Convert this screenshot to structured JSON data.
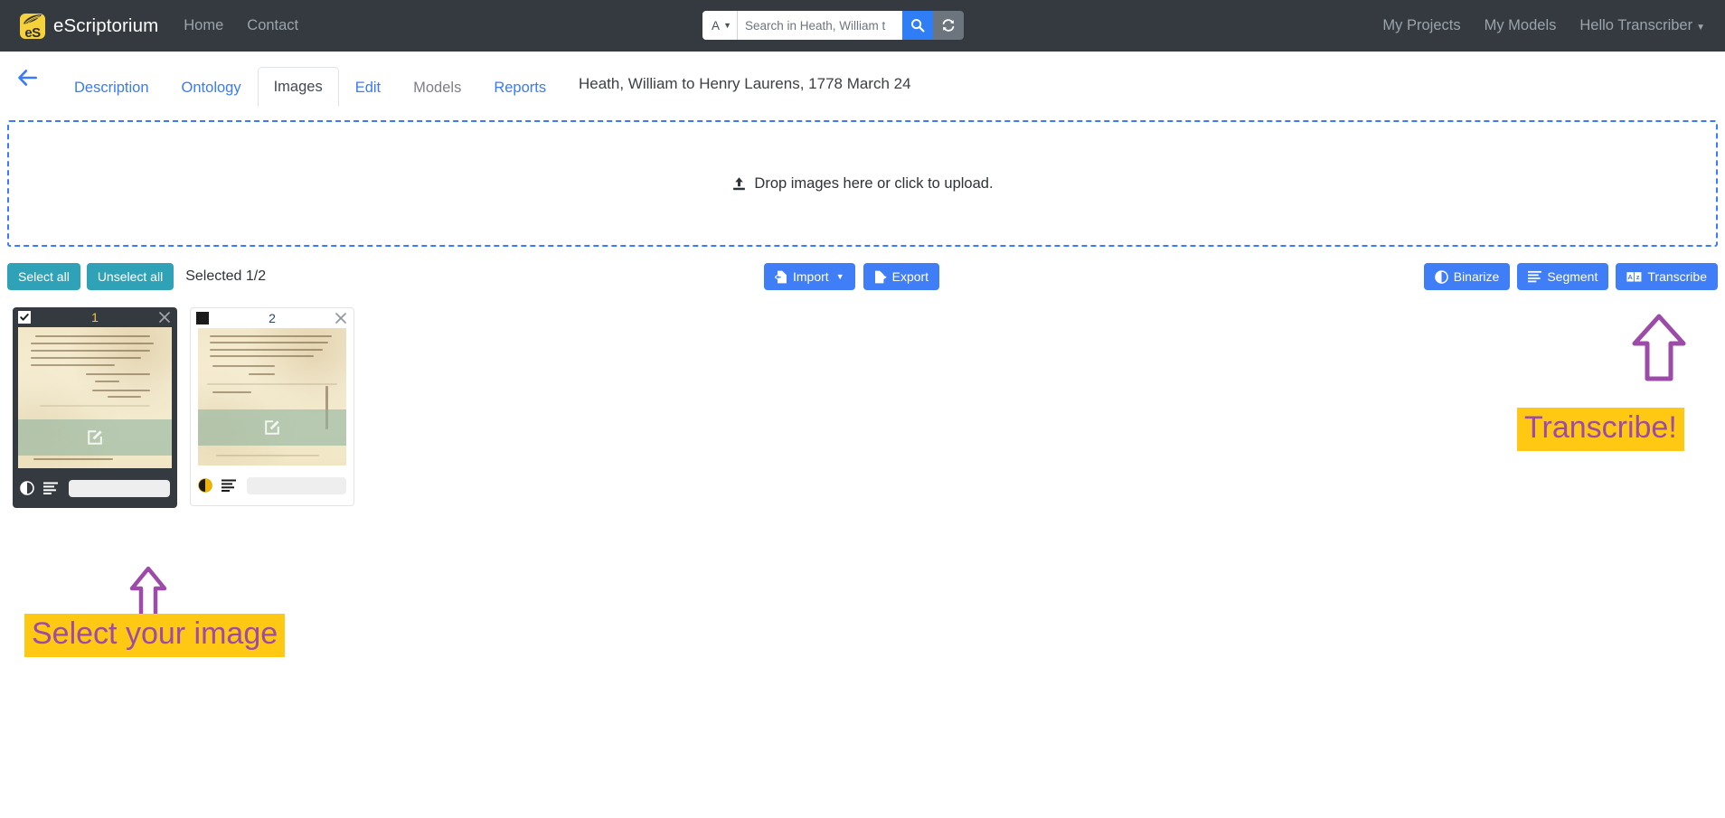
{
  "navbar": {
    "brand": "eScriptorium",
    "brand_logo_letters": "eS",
    "links": [
      {
        "label": "Home",
        "name": "nav-link-home"
      },
      {
        "label": "Contact",
        "name": "nav-link-contact"
      }
    ],
    "search": {
      "scope_value": "A",
      "scope_options": [
        "A"
      ],
      "placeholder": "Search in Heath, William t",
      "value": "",
      "search_icon": "search-icon",
      "refresh_icon": "refresh-icon"
    },
    "right_links": [
      {
        "label": "My Projects",
        "name": "nav-link-my-projects"
      },
      {
        "label": "My Models",
        "name": "nav-link-my-models"
      }
    ],
    "user_menu": "Hello Transcriber"
  },
  "tabs": {
    "back_icon": "back-arrow-icon",
    "items": [
      {
        "label": "Description",
        "active": false,
        "disabled": false
      },
      {
        "label": "Ontology",
        "active": false,
        "disabled": false
      },
      {
        "label": "Images",
        "active": true,
        "disabled": false
      },
      {
        "label": "Edit",
        "active": false,
        "disabled": false
      },
      {
        "label": "Models",
        "active": false,
        "disabled": true
      },
      {
        "label": "Reports",
        "active": false,
        "disabled": false
      }
    ],
    "document_title": "Heath, William to Henry Laurens, 1778 March 24"
  },
  "dropzone": {
    "text": "Drop images here or click to upload.",
    "icon": "upload-icon"
  },
  "toolbar": {
    "select_all": "Select all",
    "unselect_all": "Unselect all",
    "selected_count": "Selected 1/2",
    "import": "Import",
    "export": "Export",
    "binarize": "Binarize",
    "segment": "Segment",
    "transcribe": "Transcribe"
  },
  "cards": [
    {
      "number": "1",
      "selected": true,
      "checkbox_checked": true,
      "close_icon": "close-icon",
      "binarize_icon": "contrast-icon",
      "segment_icon": "lines-icon",
      "edit_icon": "edit-pencil-icon"
    },
    {
      "number": "2",
      "selected": false,
      "checkbox_checked": false,
      "close_icon": "close-icon",
      "binarize_icon": "contrast-icon",
      "segment_icon": "lines-icon",
      "edit_icon": "edit-pencil-icon"
    }
  ],
  "annotations": [
    {
      "text": "Select your image",
      "arrow": "up-arrow-annotation"
    },
    {
      "text": "Transcribe!",
      "arrow": "up-arrow-annotation"
    }
  ],
  "colors": {
    "navbar_bg": "#343a40",
    "accent_blue": "#3f7ef6",
    "accent_teal": "#30a2b7",
    "annotation_highlight": "#ffc812",
    "annotation_text": "#9c4ba8",
    "logo_yellow": "#f5d13b"
  }
}
